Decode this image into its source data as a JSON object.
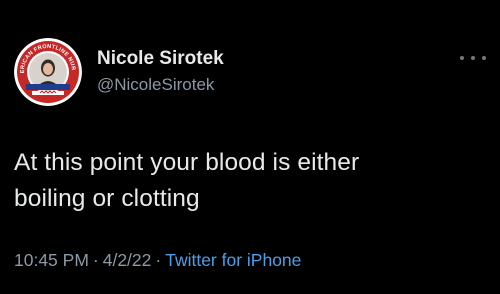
{
  "author": {
    "display_name": "Nicole Sirotek",
    "handle": "@NicoleSirotek",
    "avatar_arc_text": "AMERICAN FRONTLINE NURSES"
  },
  "tweet": {
    "text": "At this point your blood is either\nboiling or clotting",
    "time": "10:45 PM",
    "date": "4/2/22",
    "separator": "·",
    "source": "Twitter for iPhone"
  },
  "icons": {
    "more": "more-horizontal-icon"
  },
  "colors": {
    "background": "#000000",
    "primary_text": "#e7e9ea",
    "secondary_text": "#8b98a5",
    "link": "#4e9fe6",
    "avatar_ring": "#c62828"
  }
}
